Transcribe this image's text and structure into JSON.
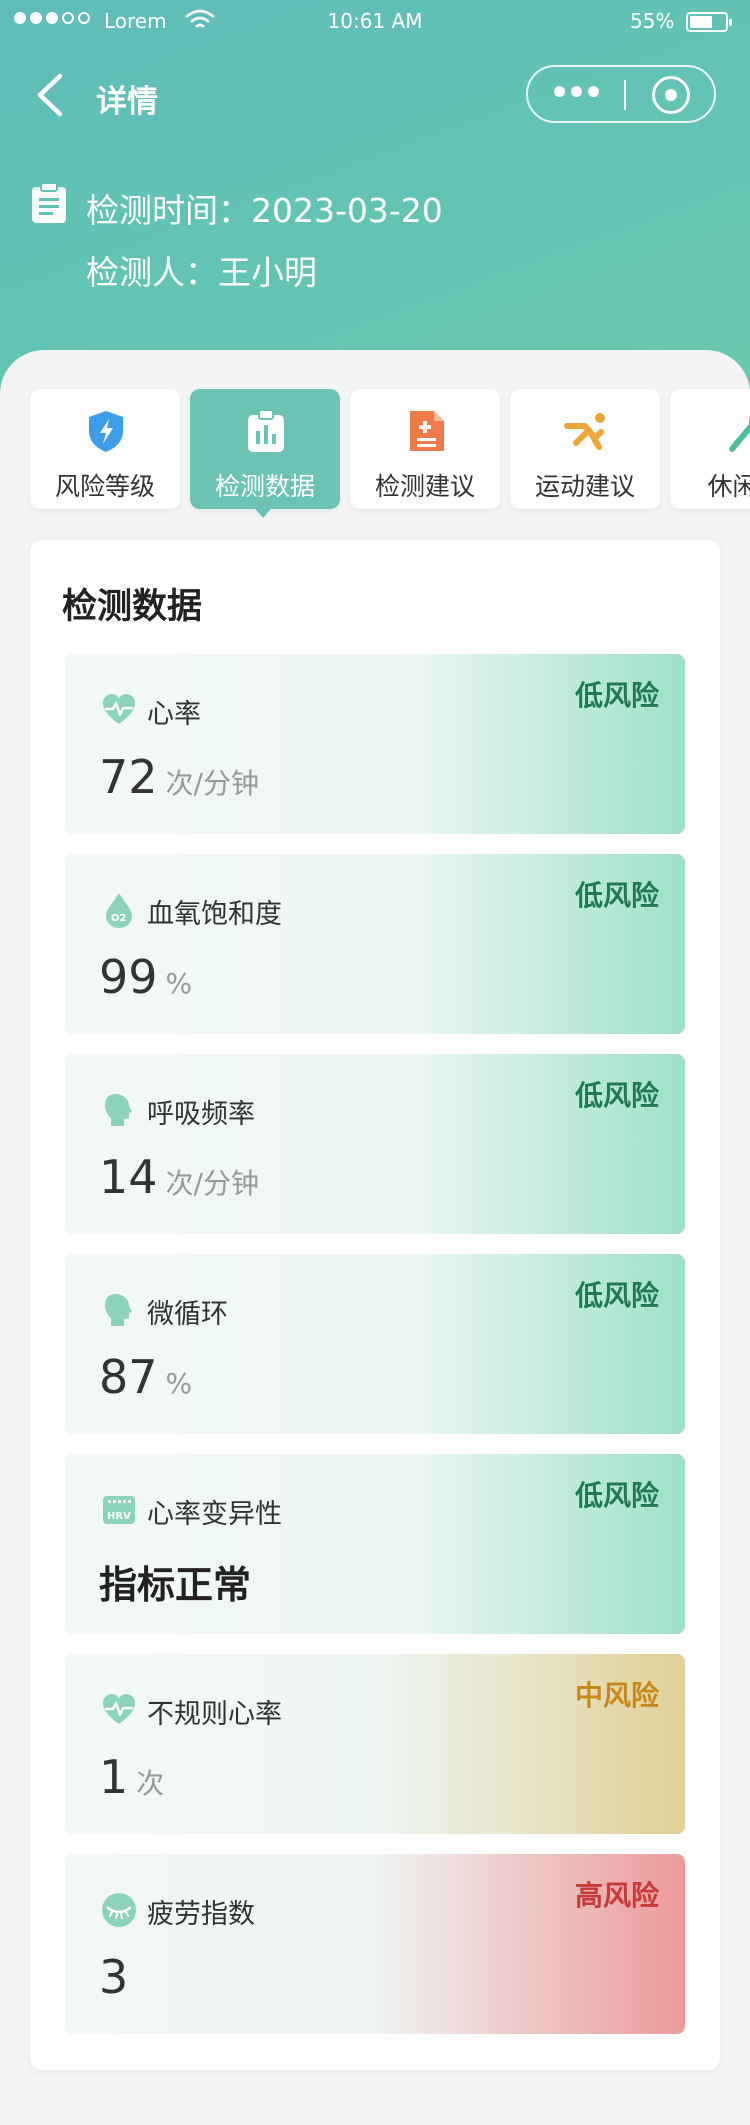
{
  "status_bar": {
    "carrier": "Lorem",
    "time": "10:61 AM",
    "battery": "55%"
  },
  "nav": {
    "title": "详情"
  },
  "info": {
    "time_line": "检测时间：2023-03-20",
    "person_line": "检测人：王小明"
  },
  "tabs": [
    {
      "label": "风险等级",
      "icon": "shield-icon"
    },
    {
      "label": "检测数据",
      "icon": "clipboard-chart-icon",
      "active": true
    },
    {
      "label": "检测建议",
      "icon": "document-icon"
    },
    {
      "label": "运动建议",
      "icon": "runner-icon"
    },
    {
      "label": "休闲娱",
      "icon": "leisure-icon"
    }
  ],
  "panel": {
    "title": "检测数据"
  },
  "metrics": [
    {
      "name": "心率",
      "value": "72",
      "unit": "次/分钟",
      "risk": "低风险",
      "level": "low",
      "icon": "heartbeat-icon"
    },
    {
      "name": "血氧饱和度",
      "value": "99",
      "unit": "%",
      "risk": "低风险",
      "level": "low",
      "icon": "oxygen-drop-icon"
    },
    {
      "name": "呼吸频率",
      "value": "14",
      "unit": "次/分钟",
      "risk": "低风险",
      "level": "low",
      "icon": "head-profile-icon"
    },
    {
      "name": "微循环",
      "value": "87",
      "unit": "%",
      "risk": "低风险",
      "level": "low",
      "icon": "head-profile-icon"
    },
    {
      "name": "心率变异性",
      "value": "指标正常",
      "unit": "",
      "risk": "低风险",
      "level": "low",
      "icon": "hrv-icon"
    },
    {
      "name": "不规则心率",
      "value": "1",
      "unit": "次",
      "risk": "中风险",
      "level": "mid",
      "icon": "heartbeat-icon"
    },
    {
      "name": "疲劳指数",
      "value": "3",
      "unit": "",
      "risk": "高风险",
      "level": "high",
      "icon": "sleepy-eye-icon"
    }
  ],
  "colors": {
    "brand": "#6cc2b3",
    "low_risk": "#1f7a55",
    "mid_risk": "#c68a1c",
    "high_risk": "#c73a3a"
  }
}
